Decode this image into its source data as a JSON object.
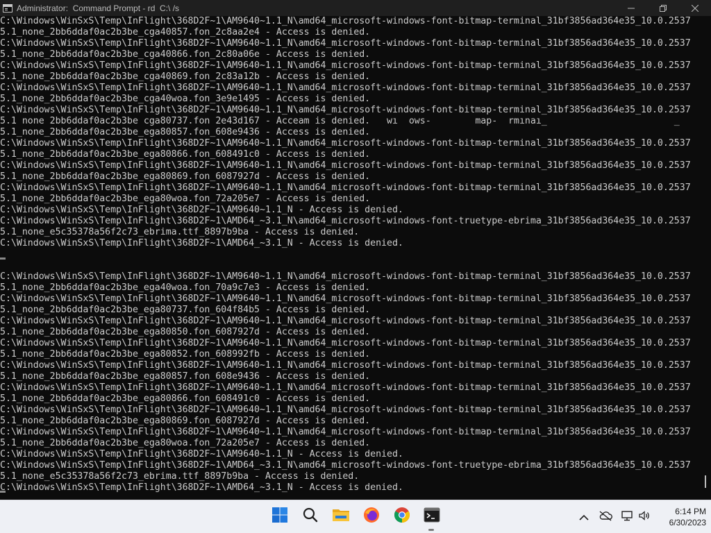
{
  "window": {
    "title": "Administrator:  Command Prompt - rd  C:\\ /s",
    "controls": [
      "minimize-icon",
      "maximize-icon",
      "close-icon"
    ]
  },
  "console_lines": [
    "C:\\Windows\\WinSxS\\Temp\\InFlight\\368D2F~1\\AM9640~1.1_N\\amd64_microsoft-windows-font-bitmap-terminal_31bf3856ad364e35_10.0.2537",
    "5.1_none_2bb6ddaf0ac2b3be_cga40857.fon_2c8aa2e4 - Access is denied.",
    "C:\\Windows\\WinSxS\\Temp\\InFlight\\368D2F~1\\AM9640~1.1_N\\amd64_microsoft-windows-font-bitmap-terminal_31bf3856ad364e35_10.0.2537",
    "5.1_none_2bb6ddaf0ac2b3be_cga40866.fon_2c80a06e - Access is denied.",
    "C:\\Windows\\WinSxS\\Temp\\InFlight\\368D2F~1\\AM9640~1.1_N\\amd64_microsoft-windows-font-bitmap-terminal_31bf3856ad364e35_10.0.2537",
    "5.1_none_2bb6ddaf0ac2b3be_cga40869.fon_2c83a12b - Access is denied.",
    "C:\\Windows\\WinSxS\\Temp\\InFlight\\368D2F~1\\AM9640~1.1_N\\amd64_microsoft-windows-font-bitmap-terminal_31bf3856ad364e35_10.0.2537",
    "5.1_none_2bb6ddaf0ac2b3be_cga40woa.fon_3e9e1495 - Access is denied.",
    "C:\\Windows\\WinSxS\\Temp\\InFlight\\368D2F~1\\AM9640~1.1_N\\amd64_microsoft-windows-font-bitmap-terminal_31bf3856ad364e35_10.0.2537",
    "5.1 none 2bb6ddaf0ac2b3be cga80737.fon 2e43d167 - Acceam is denied.   wı  ows-        map-  rmınaı_                       _",
    "5.1_none_2bb6ddaf0ac2b3be_ega80857.fon_608e9436 - Access is denied.",
    "C:\\Windows\\WinSxS\\Temp\\InFlight\\368D2F~1\\AM9640~1.1_N\\amd64_microsoft-windows-font-bitmap-terminal_31bf3856ad364e35_10.0.2537",
    "5.1_none_2bb6ddaf0ac2b3be_ega80866.fon_608491c0 - Access is denied.",
    "C:\\Windows\\WinSxS\\Temp\\InFlight\\368D2F~1\\AM9640~1.1_N\\amd64_microsoft-windows-font-bitmap-terminal_31bf3856ad364e35_10.0.2537",
    "5.1_none_2bb6ddaf0ac2b3be_ega80869.fon_6087927d - Access is denied.",
    "C:\\Windows\\WinSxS\\Temp\\InFlight\\368D2F~1\\AM9640~1.1_N\\amd64_microsoft-windows-font-bitmap-terminal_31bf3856ad364e35_10.0.2537",
    "5.1_none_2bb6ddaf0ac2b3be_ega80woa.fon_72a205e7 - Access is denied.",
    "C:\\Windows\\WinSxS\\Temp\\InFlight\\368D2F~1\\AM9640~1.1_N - Access is denied.",
    "C:\\Windows\\WinSxS\\Temp\\InFlight\\368D2F~1\\AMD64_~3.1_N\\amd64_microsoft-windows-font-truetype-ebrima_31bf3856ad364e35_10.0.2537",
    "5.1_none_e5c35378a56f2c73_ebrima.ttf_8897b9ba - Access is denied.",
    "C:\\Windows\\WinSxS\\Temp\\InFlight\\368D2F~1\\AMD64_~3.1_N - Access is denied.",
    "",
    "",
    "C:\\Windows\\WinSxS\\Temp\\InFlight\\368D2F~1\\AM9640~1.1_N\\amd64_microsoft-windows-font-bitmap-terminal_31bf3856ad364e35_10.0.2537",
    "5.1_none_2bb6ddaf0ac2b3be_ega40woa.fon_70a9c7e3 - Access is denied.",
    "C:\\Windows\\WinSxS\\Temp\\InFlight\\368D2F~1\\AM9640~1.1_N\\amd64_microsoft-windows-font-bitmap-terminal_31bf3856ad364e35_10.0.2537",
    "5.1_none_2bb6ddaf0ac2b3be_ega80737.fon_604f84b5 - Access is denied.",
    "C:\\Windows\\WinSxS\\Temp\\InFlight\\368D2F~1\\AM9640~1.1_N\\amd64_microsoft-windows-font-bitmap-terminal_31bf3856ad364e35_10.0.2537",
    "5.1_none_2bb6ddaf0ac2b3be_ega80850.fon_6087927d - Access is denied.",
    "C:\\Windows\\WinSxS\\Temp\\InFlight\\368D2F~1\\AM9640~1.1_N\\amd64_microsoft-windows-font-bitmap-terminal_31bf3856ad364e35_10.0.2537",
    "5.1_none_2bb6ddaf0ac2b3be_ega80852.fon_608992fb - Access is denied.",
    "C:\\Windows\\WinSxS\\Temp\\InFlight\\368D2F~1\\AM9640~1.1_N\\amd64_microsoft-windows-font-bitmap-terminal_31bf3856ad364e35_10.0.2537",
    "5.1_none_2bb6ddaf0ac2b3be_ega80857.fon_608e9436 - Access is denied.",
    "C:\\Windows\\WinSxS\\Temp\\InFlight\\368D2F~1\\AM9640~1.1_N\\amd64_microsoft-windows-font-bitmap-terminal_31bf3856ad364e35_10.0.2537",
    "5.1_none_2bb6ddaf0ac2b3be_ega80866.fon_608491c0 - Access is denied.",
    "C:\\Windows\\WinSxS\\Temp\\InFlight\\368D2F~1\\AM9640~1.1_N\\amd64_microsoft-windows-font-bitmap-terminal_31bf3856ad364e35_10.0.2537",
    "5.1_none_2bb6ddaf0ac2b3be_ega80869.fon_6087927d - Access is denied.",
    "C:\\Windows\\WinSxS\\Temp\\InFlight\\368D2F~1\\AM9640~1.1_N\\amd64_microsoft-windows-font-bitmap-terminal_31bf3856ad364e35_10.0.2537",
    "5.1_none_2bb6ddaf0ac2b3be_ega80woa.fon_72a205e7 - Access is denied.",
    "C:\\Windows\\WinSxS\\Temp\\InFlight\\368D2F~1\\AM9640~1.1_N - Access is denied.",
    "C:\\Windows\\WinSxS\\Temp\\InFlight\\368D2F~1\\AMD64_~3.1_N\\amd64_microsoft-windows-font-truetype-ebrima_31bf3856ad364e35_10.0.2537",
    "5.1_none_e5c35378a56f2c73_ebrima.ttf_8897b9ba - Access is denied.",
    "C:\\Windows\\WinSxS\\Temp\\InFlight\\368D2F~1\\AMD64_~3.1_N - Access is denied."
  ],
  "taskbar": {
    "apps": [
      "windows-start-icon",
      "search-icon",
      "file-explorer-icon",
      "firefox-icon",
      "chrome-icon",
      "terminal-icon"
    ],
    "active_app": "terminal-icon",
    "tray": [
      "chevron-up-icon",
      "cloud-offline-icon",
      "network-icon",
      "volume-icon"
    ],
    "clock": {
      "time": "6:14 PM",
      "date": "6/30/2023"
    }
  },
  "colors": {
    "console_bg": "#0c0c0c",
    "console_text": "#cccccc",
    "titlebar_bg": "#1f1f1f",
    "taskbar_bg": "#eef0f5"
  }
}
